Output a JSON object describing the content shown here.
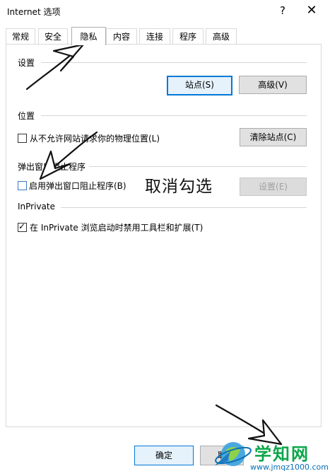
{
  "window": {
    "title": "Internet 选项",
    "help_label": "?",
    "close_label": "✕"
  },
  "tabs": [
    {
      "label": "常规"
    },
    {
      "label": "安全"
    },
    {
      "label": "隐私",
      "active": true
    },
    {
      "label": "内容"
    },
    {
      "label": "连接"
    },
    {
      "label": "程序"
    },
    {
      "label": "高级"
    }
  ],
  "settings": {
    "heading": "设置",
    "sites_button": "站点(S)",
    "advanced_button": "高级(V)"
  },
  "location": {
    "heading": "位置",
    "checkbox_label": "从不允许网站请求你的物理位置(L)",
    "checked": false,
    "clear_sites_button": "清除站点(C)"
  },
  "popup_blocker": {
    "heading": "弹出窗口阻止程序",
    "checkbox_label": "启用弹出窗口阻止程序(B)",
    "checked": false,
    "settings_button": "设置(E)",
    "settings_enabled": false
  },
  "inprivate": {
    "heading": "InPrivate",
    "checkbox_label": "在 InPrivate 浏览启动时禁用工具栏和扩展(T)",
    "checked": true
  },
  "annotation": "取消勾选",
  "footer": {
    "ok_button": "确定",
    "cancel_button": "取"
  },
  "watermark": {
    "title": "学知网",
    "url": "www.jmqz1000.com"
  },
  "colors": {
    "accent": "#0078d7",
    "watermark_green": "#0aa64a",
    "watermark_blue": "#0a6fb5"
  }
}
